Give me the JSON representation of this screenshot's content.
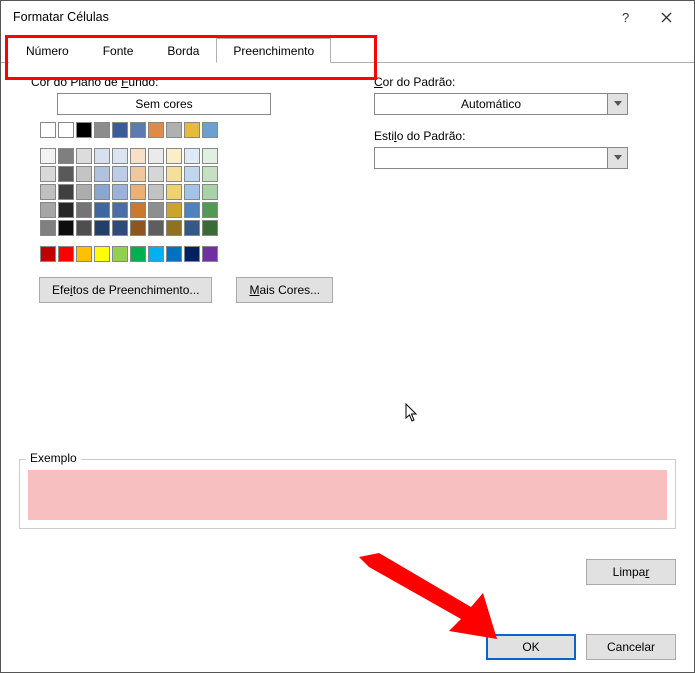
{
  "window": {
    "title": "Formatar Células"
  },
  "tabs": [
    {
      "label": "Número",
      "active": false
    },
    {
      "label": "Fonte",
      "active": false
    },
    {
      "label": "Borda",
      "active": false
    },
    {
      "label": "Preenchimento",
      "active": true
    }
  ],
  "left": {
    "bg_label_pre": "Cor do Plano de ",
    "bg_label_u": "F",
    "bg_label_post": "undo:",
    "no_color": "Sem cores",
    "fill_effects_pre": "Efe",
    "fill_effects_u": "i",
    "fill_effects_post": "tos de Preenchimento...",
    "more_colors_u": "M",
    "more_colors_post": "ais Cores..."
  },
  "right": {
    "pattern_color_u": "C",
    "pattern_color_post": "or do Padrão:",
    "pattern_color_value": "Automático",
    "pattern_style_pre": "Esti",
    "pattern_style_u": "l",
    "pattern_style_post": "o do Padrão:",
    "pattern_style_value": ""
  },
  "example": {
    "legend": "Exemplo",
    "color": "#f7bfbf"
  },
  "buttons": {
    "clear_pre": "Limpa",
    "clear_u": "r",
    "ok": "OK",
    "cancel": "Cancelar"
  },
  "palette": {
    "theme_row1": [
      "#ffffff",
      "#000000",
      "#8c8c8c",
      "#3a5c9b",
      "#5b7bb4",
      "#e08a4a",
      "#b0b0b0",
      "#e6ba3b",
      "#6c9fd2",
      "#6bb56b"
    ],
    "theme_shades": [
      [
        "#f2f2f2",
        "#7f7f7f",
        "#dcdcdc",
        "#d6e0ef",
        "#dce4f2",
        "#f7dfc8",
        "#eaeaea",
        "#f9eec8",
        "#deeaf6",
        "#e0efe0"
      ],
      [
        "#d9d9d9",
        "#595959",
        "#c4c4c4",
        "#b0c2de",
        "#bccbe6",
        "#f1c79e",
        "#d6d6d6",
        "#f4e09c",
        "#c0d6ee",
        "#c4e1c4"
      ],
      [
        "#bfbfbf",
        "#404040",
        "#adadad",
        "#8aa6cd",
        "#9bb2da",
        "#ebb074",
        "#c2c2c2",
        "#efd270",
        "#a2c2e6",
        "#a8d3a8"
      ],
      [
        "#a6a6a6",
        "#262626",
        "#747474",
        "#3f66a0",
        "#4a6da8",
        "#c97a2f",
        "#8f8f8f",
        "#cba52a",
        "#5083bd",
        "#529a52"
      ],
      [
        "#808080",
        "#0d0d0d",
        "#4e4e4e",
        "#223e6b",
        "#2f4a7a",
        "#8f551f",
        "#5e5e5e",
        "#8e721c",
        "#335a86",
        "#376c37"
      ]
    ],
    "standard": [
      "#c00000",
      "#ff0000",
      "#ffc000",
      "#ffff00",
      "#92d050",
      "#00b050",
      "#00b0f0",
      "#0070c0",
      "#002060",
      "#7030a0"
    ]
  }
}
